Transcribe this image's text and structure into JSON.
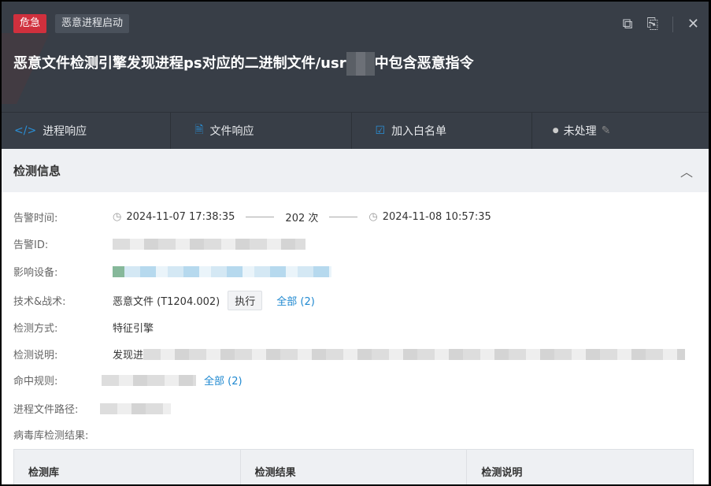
{
  "header": {
    "severity": "危急",
    "category": "恶意进程启动",
    "title_prefix": "恶意文件检测引擎发现进程ps对应的二进制文件/usr",
    "title_suffix": "中包含恶意指令"
  },
  "actions": [
    {
      "label": "进程响应",
      "icon": "code-icon"
    },
    {
      "label": "文件响应",
      "icon": "file-icon"
    },
    {
      "label": "加入白名单",
      "icon": "whitelist-icon"
    },
    {
      "label": "未处理",
      "icon": "edit-icon"
    }
  ],
  "section": {
    "title": "检测信息"
  },
  "fields": {
    "alert_time_label": "告警时间:",
    "first_time": "2024-11-07 17:38:35",
    "count": "202 次",
    "last_time": "2024-11-08 10:57:35",
    "alert_id_label": "告警ID:",
    "device_label": "影响设备:",
    "tactic_label": "技术&战术:",
    "tactic_value": "恶意文件 (T1204.002)",
    "tactic_tag": "执行",
    "tactic_all": "全部 (2)",
    "method_label": "检测方式:",
    "method_value": "特征引擎",
    "desc_label": "检测说明:",
    "desc_value": "发现进",
    "rule_label": "命中规则:",
    "rule_all": "全部 (2)",
    "path_label": "进程文件路径:",
    "virus_label": "病毒库检测结果:"
  },
  "table": {
    "columns": [
      "检测库",
      "检测结果",
      "检测说明"
    ]
  }
}
